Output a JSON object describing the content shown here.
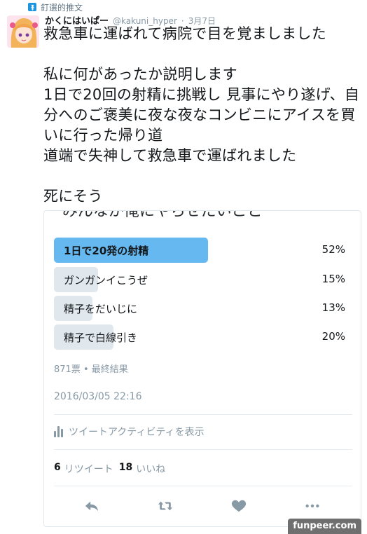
{
  "pinned": {
    "label": "釘選的推文"
  },
  "tweet": {
    "name": "かくにはいぱー",
    "handle": "@kakuni_hyper",
    "dot": "·",
    "time": "3月7日",
    "text": "救急車に運ばれて病院で目を覚ましました\n\n私に何があったか説明します\n1日で20回の射精に挑戦し 見事にやり遂げ、自分へのご褒美に夜な夜なコンビニにアイスを買いに行った帰り道\n道端で失神して救急車で運ばれました\n\n死にそう"
  },
  "poll": {
    "question": "みんなが俺にやらせたいこと",
    "choices": [
      {
        "label": "1日で20発の射精",
        "percent": "52%",
        "value": 52,
        "winner": true
      },
      {
        "label": "ガンガンイこうぜ",
        "percent": "15%",
        "value": 15,
        "winner": false
      },
      {
        "label": "精子をだいじに",
        "percent": "13%",
        "value": 13,
        "winner": false
      },
      {
        "label": "精子で白線引き",
        "percent": "20%",
        "value": 20,
        "winner": false
      }
    ],
    "meta": "871票 • 最終結果"
  },
  "timestamp": "2016/03/05 22:16",
  "activity": {
    "label": "ツイートアクティビティを表示"
  },
  "stats": {
    "retweets": "6",
    "retweets_label": "リツイート",
    "likes": "18",
    "likes_label": "いいね"
  },
  "icons": {
    "pin": "pin-icon",
    "reply": "reply-icon",
    "retweet": "retweet-icon",
    "like": "heart-icon",
    "more": "more-icon",
    "activity": "bar-chart-icon"
  },
  "colors": {
    "winner_bar": "#66b9f0",
    "bar": "#e1e8ed",
    "muted": "#8899a6",
    "accent": "#1b95e0"
  },
  "watermark": "funpeer.com"
}
